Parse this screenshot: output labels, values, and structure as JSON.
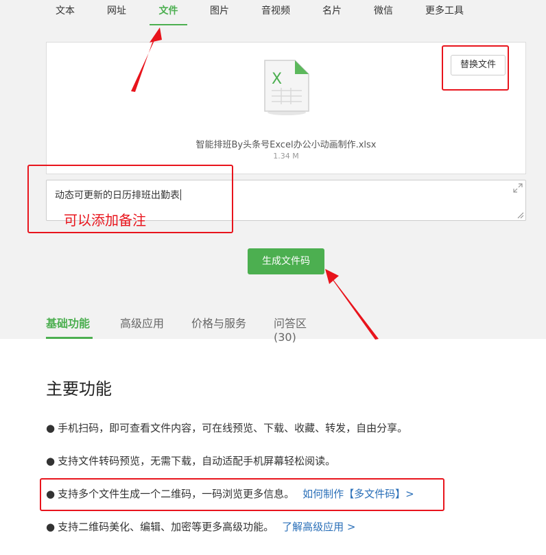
{
  "nav": {
    "tabs": [
      {
        "label": "文本"
      },
      {
        "label": "网址"
      },
      {
        "label": "文件"
      },
      {
        "label": "图片"
      },
      {
        "label": "音视频"
      },
      {
        "label": "名片"
      },
      {
        "label": "微信"
      },
      {
        "label": "更多工具"
      }
    ],
    "active_index": 2
  },
  "file": {
    "icon_letter": "X",
    "name": "智能排班By头条号Excel办公小动画制作.xlsx",
    "size": "1.34 M",
    "replace_label": "替换文件"
  },
  "note": {
    "value": "动态可更新的日历排班出勤表"
  },
  "annotation": {
    "note_hint": "可以添加备注"
  },
  "generate_label": "生成文件码",
  "section_tabs": [
    {
      "label": "基础功能"
    },
    {
      "label": "高级应用"
    },
    {
      "label": "价格与服务"
    },
    {
      "label": "问答区(30)"
    }
  ],
  "main": {
    "title": "主要功能",
    "bullet": "●",
    "features": [
      {
        "text": "手机扫码，即可查看文件内容，可在线预览、下载、收藏、转发，自由分享。",
        "link": ""
      },
      {
        "text": "支持文件转码预览，无需下载，自动适配手机屏幕轻松阅读。",
        "link": ""
      },
      {
        "text": "支持多个文件生成一个二维码，一码浏览更多信息。",
        "link": "如何制作【多文件码】>"
      },
      {
        "text": "支持二维码美化、编辑、加密等更多高级功能。",
        "link": "了解高级应用 >"
      }
    ]
  },
  "colors": {
    "accent": "#4caf50",
    "link": "#2a6fb8",
    "annotation": "#e8141c"
  }
}
